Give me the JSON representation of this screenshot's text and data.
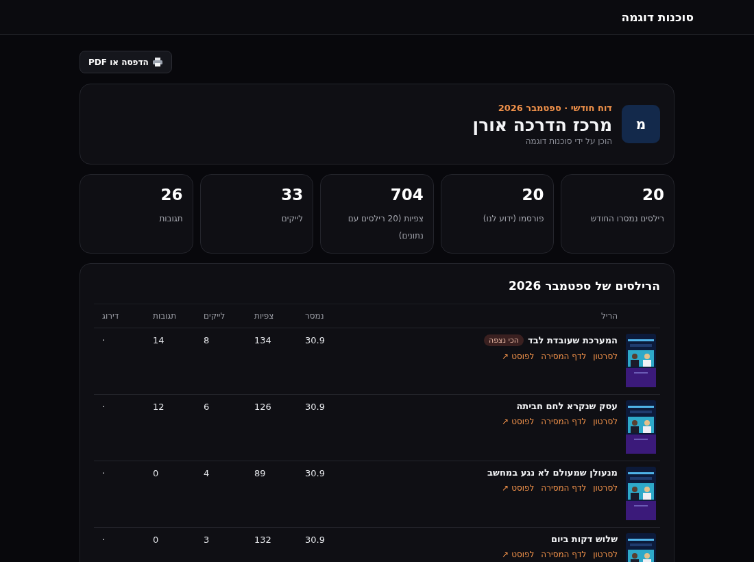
{
  "topbar": {
    "brand": "סוכנות דוגמה"
  },
  "print_button": {
    "label": "הדפסה או PDF"
  },
  "report": {
    "avatar": "מ",
    "kicker": "דוח חודשי · ספטמבר 2026",
    "title": "מרכז הדרכה אורן",
    "subtitle": "הוכן על ידי סוכנות דוגמה"
  },
  "stats": [
    {
      "value": "20",
      "label": "רילסים נמסרו החודש"
    },
    {
      "value": "20",
      "label": "פורסמו (ידוע לנו)"
    },
    {
      "value": "704",
      "label": "צפיות (20 רילסים עם נתונים)"
    },
    {
      "value": "33",
      "label": "לייקים"
    },
    {
      "value": "26",
      "label": "תגובות"
    }
  ],
  "table": {
    "title": "הרילסים של ספטמבר 2026",
    "columns": [
      "הריל",
      "נמסר",
      "צפיות",
      "לייקים",
      "תגובות",
      "דירוג"
    ],
    "rows": [
      {
        "title": "המערכת שעובדת לבד",
        "badge": "הכי נצפה",
        "links": [
          "לסרטון",
          "לדף המסירה",
          "לפוסט ↗"
        ],
        "delivered": "30.9",
        "views": "134",
        "likes": "8",
        "comments": "14",
        "rating": "·"
      },
      {
        "title": "עסק שנקרא לחם חביתה",
        "links": [
          "לסרטון",
          "לדף המסירה",
          "לפוסט ↗"
        ],
        "delivered": "30.9",
        "views": "126",
        "likes": "6",
        "comments": "12",
        "rating": "·"
      },
      {
        "title": "מנעולן שמעולם לא נגע במחשב",
        "links": [
          "לסרטון",
          "לדף המסירה",
          "לפוסט ↗"
        ],
        "delivered": "30.9",
        "views": "89",
        "likes": "4",
        "comments": "0",
        "rating": "·"
      },
      {
        "title": "שלוש דקות ביום",
        "links": [
          "לסרטון",
          "לדף המסירה",
          "לפוסט ↗"
        ],
        "delivered": "30.9",
        "views": "132",
        "likes": "3",
        "comments": "0",
        "rating": "·"
      }
    ]
  }
}
